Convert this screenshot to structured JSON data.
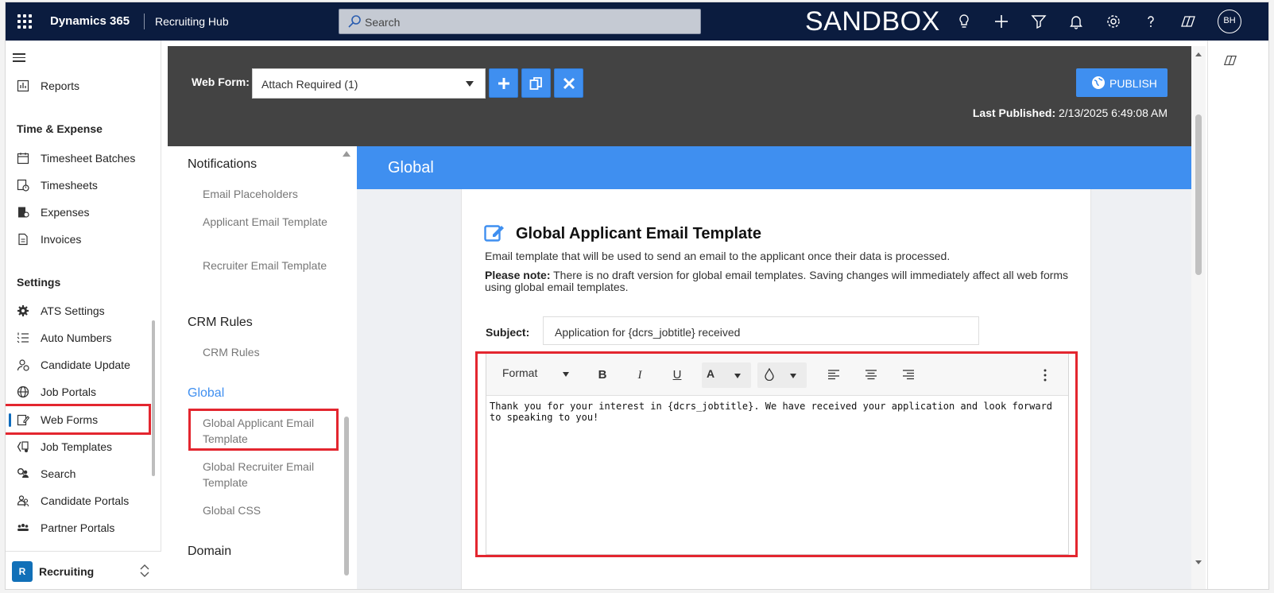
{
  "topbar": {
    "brand": "Dynamics 365",
    "app_name": "Recruiting Hub",
    "search_placeholder": "Search",
    "env_label": "SANDBOX",
    "avatar_initials": "BH"
  },
  "leftnav": {
    "items_top": [
      {
        "label": "Reports",
        "icon": "reports-icon"
      }
    ],
    "groups": [
      {
        "label": "Time & Expense",
        "items": [
          {
            "label": "Timesheet Batches",
            "icon": "calendar-icon"
          },
          {
            "label": "Timesheets",
            "icon": "timesheet-icon"
          },
          {
            "label": "Expenses",
            "icon": "expenses-icon"
          },
          {
            "label": "Invoices",
            "icon": "invoice-icon"
          }
        ]
      },
      {
        "label": "Settings",
        "items": [
          {
            "label": "ATS Settings",
            "icon": "gear-icon"
          },
          {
            "label": "Auto Numbers",
            "icon": "numbered-list-icon"
          },
          {
            "label": "Candidate Update",
            "icon": "person-sync-icon"
          },
          {
            "label": "Job Portals",
            "icon": "globe-icon"
          },
          {
            "label": "Web Forms",
            "icon": "form-edit-icon",
            "selected": true
          },
          {
            "label": "Job Templates",
            "icon": "template-icon"
          },
          {
            "label": "Search",
            "icon": "search-people-icon"
          },
          {
            "label": "Candidate Portals",
            "icon": "people-icon"
          },
          {
            "label": "Partner Portals",
            "icon": "group-icon"
          }
        ]
      }
    ],
    "area": {
      "initial": "R",
      "label": "Recruiting"
    }
  },
  "webform": {
    "label": "Web Form:",
    "selected": "Attach Required (1)",
    "publish_label": "PUBLISH",
    "last_published_label": "Last Published:",
    "last_published_value": "2/13/2025 6:49:08 AM"
  },
  "innernav": {
    "groups": [
      {
        "label": "Notifications",
        "items": [
          "Email Placeholders",
          "Applicant Email Template",
          "Recruiter Email Template"
        ]
      },
      {
        "label": "CRM Rules",
        "items": [
          "CRM Rules"
        ]
      },
      {
        "label": "Global",
        "active": true,
        "items": [
          "Global Applicant Email Template",
          "Global Recruiter Email Template",
          "Global CSS"
        ]
      },
      {
        "label": "Domain",
        "items": []
      }
    ]
  },
  "content": {
    "banner": "Global",
    "title": "Global Applicant Email Template",
    "description": "Email template that will be used to send an email to the applicant once their data is processed.",
    "note_label": "Please note:",
    "note_text": "There is no draft version for global email templates. Saving changes will immediately affect all web forms using global email templates.",
    "subject_label": "Subject:",
    "subject_value": "Application for {dcrs_jobtitle} received",
    "editor": {
      "format_label": "Format",
      "bold": "B",
      "italic": "I",
      "underline": "U",
      "font_color": "A",
      "body": "Thank you for your interest in {dcrs_jobtitle}. We have received your application and look forward to speaking to you!"
    }
  },
  "colors": {
    "topbar": "#0b1c3f",
    "accent": "#3f8ff0",
    "highlight": "#e3262f",
    "header_dark": "#434343"
  }
}
